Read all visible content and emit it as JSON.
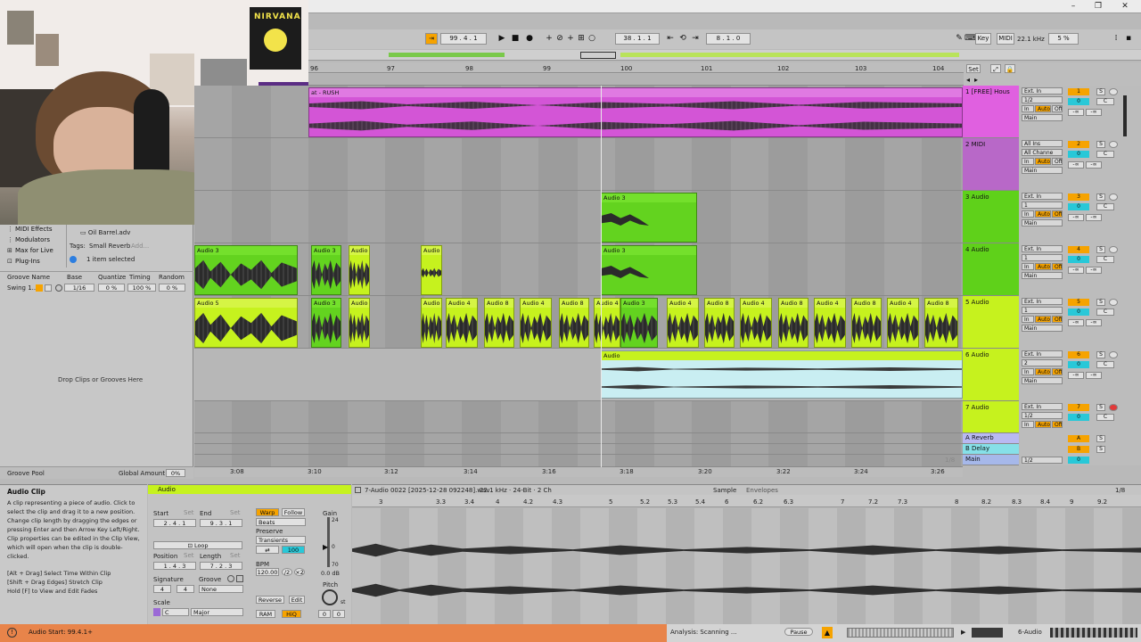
{
  "transport": {
    "position": "99 . 4 . 1",
    "loop_start": "38 . 1 . 1",
    "loop_length": "8 . 1 . 0",
    "key_label": "Key",
    "midi_label": "MIDI",
    "sample_rate": "22.1 kHz",
    "cpu": "5 %"
  },
  "browser": {
    "items": [
      {
        "label": "MIDI Effects",
        "icon": "midi-effects-icon"
      },
      {
        "label": "Modulators",
        "icon": "modulators-icon"
      },
      {
        "label": "Max for Live",
        "icon": "max-for-live-icon"
      },
      {
        "label": "Plug-Ins",
        "icon": "plugins-icon"
      }
    ],
    "file": "Oil Barrel.adv",
    "tags_label": "Tags:",
    "tag_value": "Small Reverb",
    "tag_add": "Add...",
    "selection": "1 item selected",
    "groove_headers": [
      "Groove Name",
      "Base",
      "Quantize",
      "Timing",
      "Random"
    ],
    "groove_row": [
      "Swing 1...",
      "1/16",
      "0 %",
      "100 %",
      "0 %"
    ],
    "drop_hint": "Drop Clips or Grooves Here",
    "groove_pool": "Groove Pool",
    "global_amount_label": "Global Amount",
    "global_amount": "0%"
  },
  "ruler": [
    "96",
    "97",
    "98",
    "99",
    "100",
    "101",
    "102",
    "103",
    "104"
  ],
  "time_axis": [
    "3:08",
    "3:10",
    "3:12",
    "3:14",
    "3:16",
    "3:18",
    "3:20",
    "3:22",
    "3:24",
    "3:26"
  ],
  "zoom_label": "1/8",
  "set_label": "Set",
  "tracks": [
    {
      "name": "1 [FREE] Hous",
      "input": "Ext. In",
      "channel": "1/2",
      "number": "1",
      "color": "#e060e0"
    },
    {
      "name": "2 MIDI",
      "input": "All Ins",
      "channel": "All Channe",
      "number": "2",
      "color": "#b868c8"
    },
    {
      "name": "3 Audio",
      "input": "Ext. In",
      "channel": "1",
      "number": "3",
      "color": "#5fd11a"
    },
    {
      "name": "4 Audio",
      "input": "Ext. In",
      "channel": "1",
      "number": "4",
      "color": "#5fd11a"
    },
    {
      "name": "5 Audio",
      "input": "Ext. In",
      "channel": "1",
      "number": "5",
      "color": "#c6f21e"
    },
    {
      "name": "6 Audio",
      "input": "Ext. In",
      "channel": "2",
      "number": "6",
      "color": "#c6f21e"
    },
    {
      "name": "7 Audio",
      "input": "Ext. In",
      "channel": "1/2",
      "number": "7",
      "color": "#c6f21e"
    }
  ],
  "returns": [
    {
      "name": "A Reverb",
      "letter": "A"
    },
    {
      "name": "B Delay",
      "letter": "B"
    }
  ],
  "main": {
    "name": "Main",
    "channel": "1/2"
  },
  "io_common": {
    "in": "In",
    "auto": "Auto",
    "off": "Off",
    "main": "Main",
    "vol": "0",
    "pan": "C",
    "neg_inf": "-∞",
    "solo": "S"
  },
  "clips": {
    "track1": "at - RUSH",
    "audio3": "Audio 3",
    "audio4": "Audio 4",
    "audio5": "Audio 5",
    "audio8": "Audio 8",
    "audio": "Audio"
  },
  "clipinfo": {
    "title": "Audio Clip",
    "text": "A clip representing a piece of audio. Click to select the clip and drag it to a new position. Change clip length by dragging the edges or pressing Enter and then Arrow Key Left/Right. Clip properties can be edited in the Clip View, which will open when the clip is double-clicked.",
    "hints": [
      "[Alt + Drag] Select Time Within Clip",
      "[Shift + Drag Edges] Stretch Clip",
      "Hold [F] to View and Edit Fades"
    ]
  },
  "clipprops": {
    "name": "Audio",
    "start_label": "Start",
    "end_label": "End",
    "set": "Set",
    "start": "2 . 4 . 1",
    "end": "9 . 3 . 1",
    "loop": "Loop",
    "position_label": "Position",
    "length_label": "Length",
    "position": "1 . 4 . 3",
    "length": "7 . 2 . 3",
    "signature_label": "Signature",
    "groove_label": "Groove",
    "sig_num": "4",
    "sig_den": "4",
    "groove": "None",
    "scale_label": "Scale",
    "scale_root": "C",
    "scale_mode": "Major",
    "warp": "Warp",
    "follow": "Follow",
    "beats": "Beats",
    "preserve": "Preserve",
    "transients": "Transients",
    "transient_val": "100",
    "bpm_label": "BPM",
    "bpm": "120.00",
    "half": "/2",
    "double": "×2",
    "reverse": "Reverse",
    "edit": "Edit",
    "ram": "RAM",
    "hiq": "HiQ",
    "gain_label": "Gain",
    "gain_top": "24",
    "gain_mid": "0",
    "gain_bot": "70",
    "gain_db": "0.0 dB",
    "pitch_label": "Pitch",
    "pitch_st": "st",
    "pitch_val": "0",
    "pitch_cents": "0"
  },
  "sampleview": {
    "file": "7-Audio 0022 [2025-12-28 092248].wav",
    "format": "22.1 kHz · 24-Bit · 2 Ch",
    "tab_sample": "Sample",
    "tab_env": "Envelopes",
    "zoom": "1/8",
    "ticks": [
      "3",
      "3.3",
      "3.4",
      "4",
      "4.2",
      "4.3",
      "5",
      "5.2",
      "5.3",
      "5.4",
      "6",
      "6.2",
      "6.3",
      "7",
      "7.2",
      "7.3",
      "8",
      "8.2",
      "8.3",
      "8.4",
      "9",
      "9.2"
    ]
  },
  "status": {
    "left": "Audio Start: 99.4.1+",
    "analysis": "Analysis: Scanning ...",
    "pause": "Pause",
    "right_track": "6-Audio"
  },
  "colors": {
    "accent": "#f6a300",
    "track_magenta": "#e060e0",
    "track_green": "#5fd11a",
    "track_lime": "#c6f21e",
    "status_bar": "#e8844a",
    "volume_cyan": "#28c8d8"
  }
}
